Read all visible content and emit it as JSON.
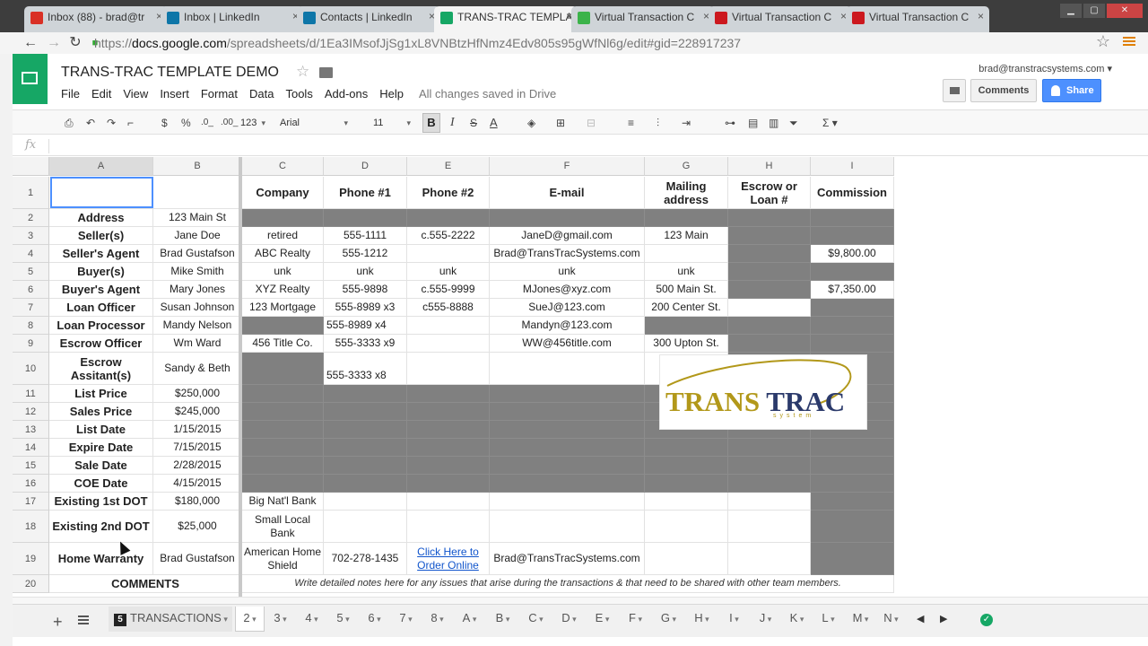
{
  "browser": {
    "tabs": [
      {
        "label": "Inbox (88) - brad@tr",
        "icon": "gmail-icon",
        "color": "#d93025"
      },
      {
        "label": "Inbox | LinkedIn",
        "icon": "linkedin-icon",
        "color": "#0e76a8"
      },
      {
        "label": "Contacts | LinkedIn",
        "icon": "linkedin-icon",
        "color": "#0e76a8"
      },
      {
        "label": "TRANS-TRAC TEMPLA",
        "icon": "sheets-icon",
        "color": "#16a765"
      },
      {
        "label": "Virtual Transaction C",
        "icon": "u-icon",
        "color": "#3bb34a"
      },
      {
        "label": "Virtual Transaction C",
        "icon": "youtube-icon",
        "color": "#cc181e"
      },
      {
        "label": "Virtual Transaction C",
        "icon": "youtube-icon",
        "color": "#cc181e"
      }
    ],
    "url_prefix": "https://",
    "url_host": "docs.google.com",
    "url_path": "/spreadsheets/d/1Ea3IMsofJjSg1xL8VNBtzHfNmz4Edv805s95gWfNl6g/edit#gid=228917237"
  },
  "doc": {
    "title": "TRANS-TRAC TEMPLATE DEMO",
    "menu": [
      "File",
      "Edit",
      "View",
      "Insert",
      "Format",
      "Data",
      "Tools",
      "Add-ons",
      "Help"
    ],
    "saved_status": "All changes saved in Drive",
    "user": "brad@transtracsystems.com",
    "comments_label": "Comments",
    "share_label": "Share"
  },
  "toolbar": {
    "currency": "$",
    "percent": "%",
    "dec_less": ".0_",
    "dec_more": ".00_",
    "number_format": "123",
    "font": "Arial",
    "font_size": "11",
    "bold": "B",
    "italic": "I",
    "strike": "S",
    "text_color": "A"
  },
  "formula": {
    "fx": "fx"
  },
  "columns": [
    "A",
    "B",
    "C",
    "D",
    "E",
    "F",
    "G",
    "H",
    "I"
  ],
  "rows": [
    "1",
    "2",
    "3",
    "4",
    "5",
    "6",
    "7",
    "8",
    "9",
    "10",
    "11",
    "12",
    "13",
    "14",
    "15",
    "16",
    "17",
    "18",
    "19",
    "20"
  ],
  "header_row": {
    "C": "Company",
    "D": "Phone #1",
    "E": "Phone #2",
    "F": "E-mail",
    "G": "Mailing address",
    "H": "Escrow or Loan #",
    "I": "Commission"
  },
  "labels": [
    "Address",
    "Seller(s)",
    "Seller's Agent",
    "Buyer(s)",
    "Buyer's Agent",
    "Loan Officer",
    "Loan Processor",
    "Escrow Officer",
    "Escrow Assitant(s)",
    "List Price",
    "Sales Price",
    "List Date",
    "Expire Date",
    "Sale Date",
    "COE Date",
    "Existing 1st DOT",
    "Existing 2nd DOT",
    "Home Warranty"
  ],
  "values_b": [
    "123 Main St",
    "Jane Doe",
    "Brad Gustafson",
    "Mike Smith",
    "Mary Jones",
    "Susan Johnson",
    "Mandy Nelson",
    "Wm Ward",
    "Sandy & Beth",
    "$250,000",
    "$245,000",
    "1/15/2015",
    "7/15/2015",
    "2/28/2015",
    "4/15/2015",
    "$180,000",
    "$25,000",
    "Brad Gustafson"
  ],
  "cells": {
    "r3": {
      "C": "retired",
      "D": "555-1111",
      "E": "c.555-2222",
      "F": "JaneD@gmail.com",
      "G": "123 Main"
    },
    "r4": {
      "C": "ABC Realty",
      "D": "555-1212",
      "F": "Brad@TransTracSystems.com",
      "I": "$9,800.00"
    },
    "r5": {
      "C": "unk",
      "D": "unk",
      "E": "unk",
      "F": "unk",
      "G": "unk"
    },
    "r6": {
      "C": "XYZ Realty",
      "D": "555-9898",
      "E": "c.555-9999",
      "F": "MJones@xyz.com",
      "G": "500 Main St.",
      "I": "$7,350.00"
    },
    "r7": {
      "C": "123 Mortgage",
      "D": "555-8989 x3",
      "E": "c555-8888",
      "F": "SueJ@123.com",
      "G": "200 Center St."
    },
    "r8": {
      "D": "555-8989 x4",
      "F": "Mandyn@123.com"
    },
    "r9": {
      "C": "456 Title Co.",
      "D": "555-3333 x9",
      "F": "WW@456title.com",
      "G": "300 Upton St."
    },
    "r10": {
      "D": "555-3333 x8"
    },
    "r17": {
      "C": "Big Nat'l Bank"
    },
    "r18": {
      "C": "Small Local Bank"
    },
    "r19": {
      "C": "American Home Shield",
      "D": "702-278-1435",
      "E": "Click Here to Order Online",
      "F": "Brad@TransTracSystems.com"
    }
  },
  "comments_row": {
    "label": "COMMENTS",
    "note": "Write detailed notes here for any issues that arise during the transactions & that need to be shared with other team members."
  },
  "brand": {
    "part1": "TRANS",
    "part2": "TRAC",
    "tagline": "system"
  },
  "sheets": {
    "main_number": "5",
    "main_label": "TRANSACTIONS",
    "tabs": [
      "2",
      "3",
      "4",
      "5",
      "6",
      "7",
      "8",
      "A",
      "B",
      "C",
      "D",
      "E",
      "F",
      "G",
      "H",
      "I",
      "J",
      "K",
      "L",
      "M",
      "N"
    ]
  },
  "colors": {
    "dark_fill": "#808080",
    "accent": "#4d90fe",
    "sheets_green": "#16a765",
    "brand_gold": "#b2981a",
    "brand_navy": "#2b3a6b"
  }
}
